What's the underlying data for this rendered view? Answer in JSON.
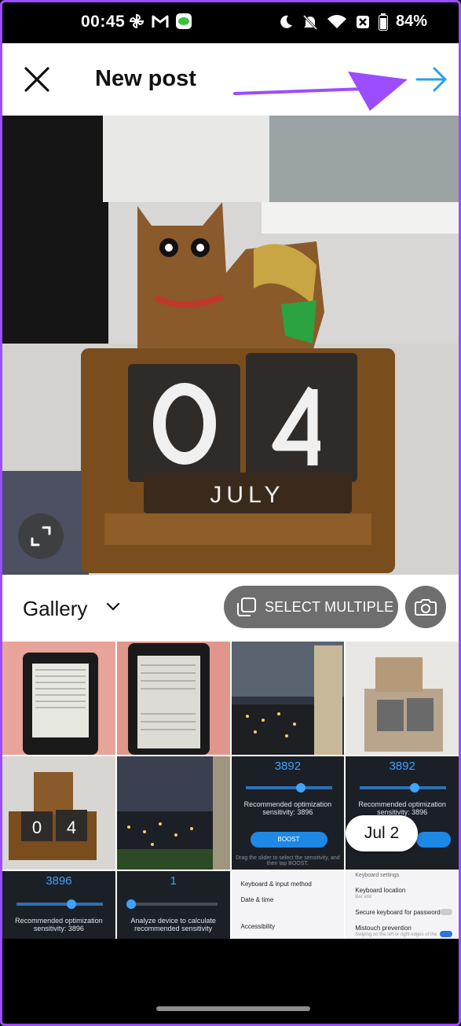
{
  "status_bar": {
    "time": "00:45",
    "battery": "84%",
    "left_icons": [
      "pinwheel-icon",
      "gmail-icon",
      "line-icon"
    ],
    "right_icons": [
      "moon-icon",
      "bell-off-icon",
      "wifi-icon",
      "nosim-icon",
      "battery-icon"
    ]
  },
  "header": {
    "title": "New post",
    "close_icon": "close-icon",
    "next_icon": "arrow-right-icon",
    "accent": "#2aa0e8",
    "annotation_color": "#9b4dff"
  },
  "gallery_bar": {
    "source_label": "Gallery",
    "select_multiple_label": "SELECT MULTIPLE",
    "camera_icon": "camera-icon"
  },
  "grid": {
    "date_chip": "Jul 2",
    "tiles": [
      {
        "kind": "kindle"
      },
      {
        "kind": "kindle2"
      },
      {
        "kind": "night-city"
      },
      {
        "kind": "calendar-faded"
      },
      {
        "kind": "calendar"
      },
      {
        "kind": "night-city2"
      },
      {
        "kind": "settings-boost",
        "number": "3892",
        "caption": "Recommended optimization sensitivity: 3896",
        "button": "BOOST",
        "footnote": "Drag the slider to select the sensitivity, and then tap BOOST."
      },
      {
        "kind": "settings-boost2",
        "number": "3892",
        "caption": "Recommended optimization sensitivity: 3896"
      },
      {
        "kind": "settings-slider",
        "number": "3896",
        "caption": "Recommended optimization sensitivity: 3896"
      },
      {
        "kind": "settings-slider2",
        "number": "1",
        "caption": "Analyze device to calculate recommended sensitivity"
      },
      {
        "kind": "settings-list",
        "items": [
          "Keyboard & input method",
          "Date & time",
          "Accessibility"
        ]
      },
      {
        "kind": "settings-list2",
        "header": "Keyboard settings",
        "items": [
          "Keyboard location",
          "Secure keyboard for passwords",
          "Mistouch prevention"
        ],
        "sub": [
          "Bar and",
          "",
          "Swiping on the left or right edges of the"
        ]
      }
    ]
  }
}
